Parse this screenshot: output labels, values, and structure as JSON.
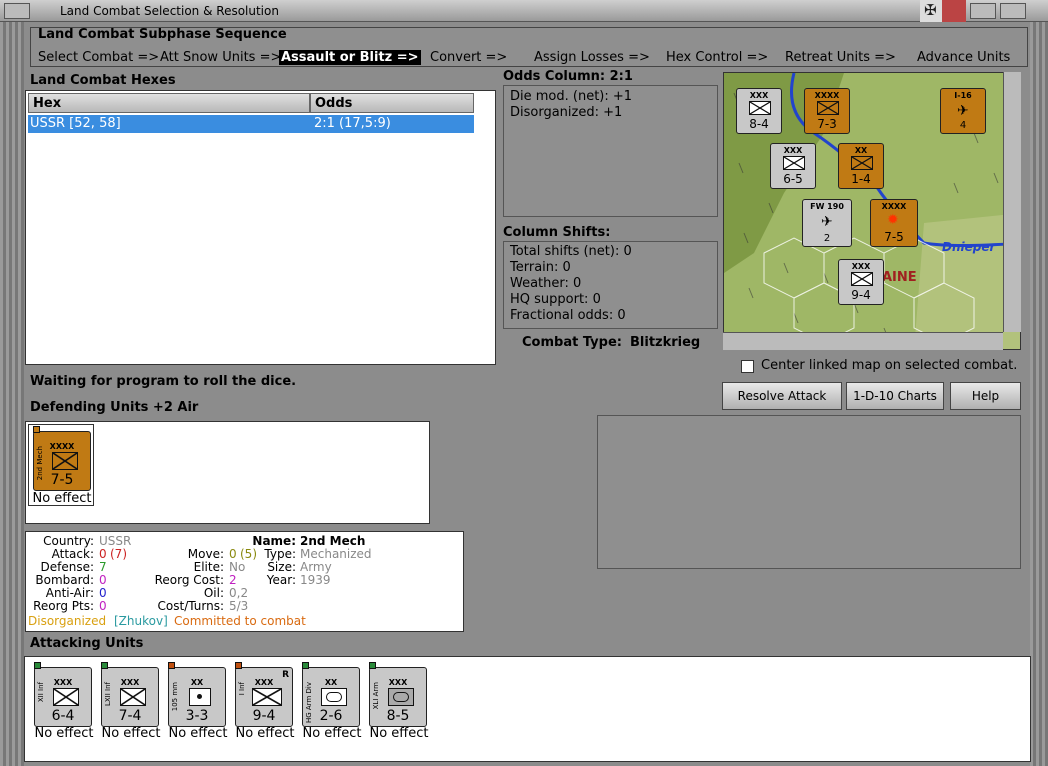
{
  "window": {
    "title": "Land Combat Selection & Resolution"
  },
  "sequence": {
    "title": "Land Combat Subphase Sequence",
    "steps": [
      "Select Combat =>",
      "Att Snow Units =>",
      "Assault or Blitz =>",
      "Convert =>",
      "Assign Losses =>",
      "Hex Control =>",
      "Retreat Units =>",
      "Advance Units"
    ],
    "active_index": 2
  },
  "hexes": {
    "title": "Land Combat Hexes",
    "columns": [
      "Hex",
      "Odds"
    ],
    "rows": [
      {
        "hex": "USSR [52, 58]",
        "odds": "2:1 (17,5:9)"
      }
    ]
  },
  "odds": {
    "title": "Odds Column: 2:1",
    "lines": [
      "Die mod. (net): +1",
      "Disorganized: +1"
    ]
  },
  "shifts": {
    "title": "Column Shifts:",
    "lines": [
      "Total shifts (net): 0",
      "Terrain: 0",
      "Weather: 0",
      "HQ support: 0",
      "Fractional odds: 0"
    ],
    "combat_type_label": "Combat Type:",
    "combat_type": "Blitzkrieg"
  },
  "map": {
    "river_label": "Dnieper",
    "region_label": "AINE",
    "center_label": "Center linked map on selected combat."
  },
  "status": "Waiting for program to roll the dice.",
  "buttons": {
    "resolve": "Resolve Attack",
    "charts": "1-D-10 Charts",
    "help": "Help"
  },
  "defending": {
    "title": "Defending Units +2 Air",
    "units": [
      {
        "label": "2nd Mech",
        "size": "XXXX",
        "values": "7-5",
        "effect": "No effect"
      }
    ]
  },
  "details": {
    "country_label": "Country:",
    "country": "USSR",
    "attack_label": "Attack:",
    "attack": "0",
    "attack_paren": "(7)",
    "defense_label": "Defense:",
    "defense": "7",
    "bombard_label": "Bombard:",
    "bombard": "0",
    "antiair_label": "Anti-Air:",
    "antiair": "0",
    "reorgpts_label": "Reorg Pts:",
    "reorgpts": "0",
    "name_label": "Name:",
    "name": "2nd Mech",
    "move_label": "Move:",
    "move": "0",
    "move_paren": "(5)",
    "type_label": "Type:",
    "type": "Mechanized",
    "elite_label": "Elite:",
    "elite": "No",
    "size_label": "Size:",
    "size": "Army",
    "reorgcost_label": "Reorg Cost:",
    "reorgcost": "2",
    "year_label": "Year:",
    "year": "1939",
    "oil_label": "Oil:",
    "oil": "0,2",
    "costturns_label": "Cost/Turns:",
    "costturns": "5/3",
    "status1": "Disorganized",
    "status2": "[Zhukov]",
    "status3": "Committed to combat"
  },
  "attacking": {
    "title": "Attacking Units",
    "units": [
      {
        "label": "XII Inf",
        "size": "XXX",
        "values": "6-4",
        "effect": "No effect"
      },
      {
        "label": "LXII Inf",
        "size": "XXX",
        "values": "7-4",
        "effect": "No effect"
      },
      {
        "label": "105 mm",
        "size": "XX",
        "values": "3-3",
        "effect": "No effect"
      },
      {
        "label": "I Inf",
        "size": "XXX",
        "values": "9-4",
        "effect": "No effect"
      },
      {
        "label": "HG Arm Div",
        "size": "XX",
        "values": "2-6",
        "effect": "No effect"
      },
      {
        "label": "XLI Arm",
        "size": "XXX",
        "values": "8-5",
        "effect": "No effect"
      }
    ]
  },
  "map_units": [
    {
      "size": "XXX",
      "values": "8-4"
    },
    {
      "size": "XXXX",
      "values": "7-3"
    },
    {
      "size": "XXX",
      "values": "6-5"
    },
    {
      "size": "XX",
      "values": "1-4"
    },
    {
      "size": "FW 190",
      "values": "2"
    },
    {
      "size": "XXXX",
      "values": "7-5"
    },
    {
      "size": "XXX",
      "values": "9-4"
    },
    {
      "size": "I-16",
      "values": "4"
    }
  ],
  "colors": {
    "accent_select": "#3a8de0",
    "soviet_unit": "#c07a14",
    "german_unit": "#c8c8c8",
    "active_step_bg": "#000000"
  }
}
